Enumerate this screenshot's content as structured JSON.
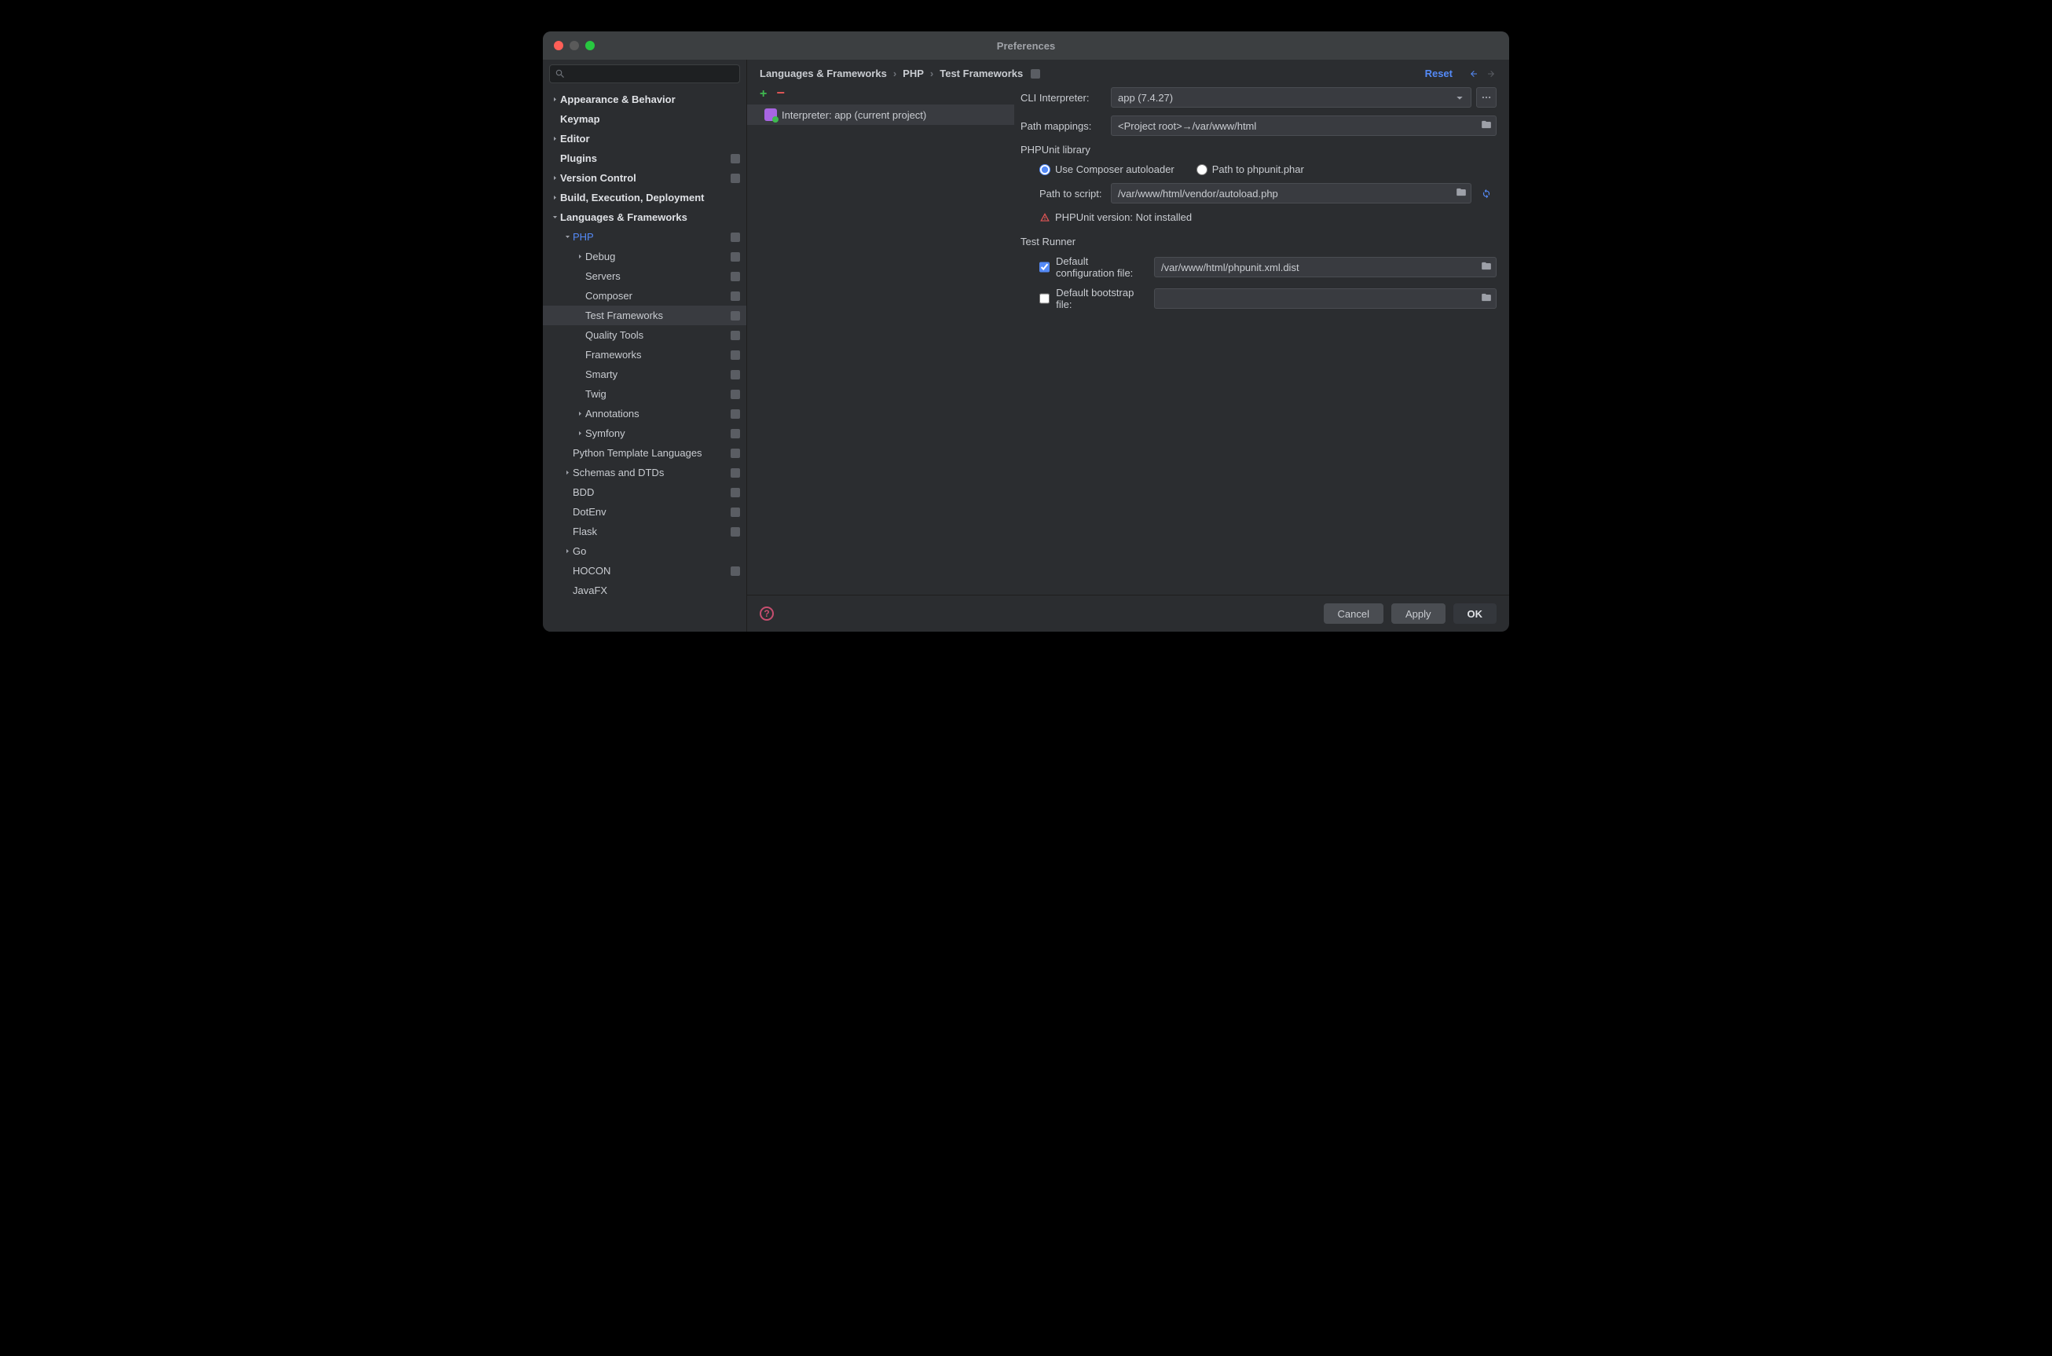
{
  "window": {
    "title": "Preferences"
  },
  "breadcrumb": {
    "a": "Languages & Frameworks",
    "b": "PHP",
    "c": "Test Frameworks"
  },
  "topbar": {
    "reset": "Reset"
  },
  "sidebar": {
    "items": [
      {
        "label": "Appearance & Behavior",
        "indent": 0,
        "chev": "right",
        "bold": true
      },
      {
        "label": "Keymap",
        "indent": 0,
        "bold": true
      },
      {
        "label": "Editor",
        "indent": 0,
        "chev": "right",
        "bold": true
      },
      {
        "label": "Plugins",
        "indent": 0,
        "bold": true,
        "badge": true
      },
      {
        "label": "Version Control",
        "indent": 0,
        "chev": "right",
        "bold": true,
        "badge": true
      },
      {
        "label": "Build, Execution, Deployment",
        "indent": 0,
        "chev": "right",
        "bold": true
      },
      {
        "label": "Languages & Frameworks",
        "indent": 0,
        "chev": "down",
        "bold": true
      },
      {
        "label": "PHP",
        "indent": 1,
        "chev": "down",
        "badge": true,
        "blue": true
      },
      {
        "label": "Debug",
        "indent": 2,
        "chev": "right",
        "badge": true
      },
      {
        "label": "Servers",
        "indent": 2,
        "badge": true
      },
      {
        "label": "Composer",
        "indent": 2,
        "badge": true
      },
      {
        "label": "Test Frameworks",
        "indent": 2,
        "badge": true,
        "selected": true
      },
      {
        "label": "Quality Tools",
        "indent": 2,
        "badge": true
      },
      {
        "label": "Frameworks",
        "indent": 2,
        "badge": true
      },
      {
        "label": "Smarty",
        "indent": 2,
        "badge": true
      },
      {
        "label": "Twig",
        "indent": 2,
        "badge": true
      },
      {
        "label": "Annotations",
        "indent": 2,
        "chev": "right",
        "badge": true
      },
      {
        "label": "Symfony",
        "indent": 2,
        "chev": "right",
        "badge": true
      },
      {
        "label": "Python Template Languages",
        "indent": 1,
        "badge": true
      },
      {
        "label": "Schemas and DTDs",
        "indent": 1,
        "chev": "right",
        "badge": true
      },
      {
        "label": "BDD",
        "indent": 1,
        "badge": true
      },
      {
        "label": "DotEnv",
        "indent": 1,
        "badge": true
      },
      {
        "label": "Flask",
        "indent": 1,
        "badge": true
      },
      {
        "label": "Go",
        "indent": 1,
        "chev": "right"
      },
      {
        "label": "HOCON",
        "indent": 1,
        "badge": true
      },
      {
        "label": "JavaFX",
        "indent": 1
      }
    ]
  },
  "listpanel": {
    "item0": "Interpreter: app (current project)"
  },
  "form": {
    "cli_label": "CLI Interpreter:",
    "cli_value": "app (7.4.27)",
    "path_map_label": "Path mappings:",
    "path_map_value": "<Project root>→/var/www/html",
    "lib_section": "PHPUnit library",
    "radio_composer": "Use Composer autoloader",
    "radio_phar": "Path to phpunit.phar",
    "script_label": "Path to script:",
    "script_value": "/var/www/html/vendor/autoload.php",
    "status": "PHPUnit version: Not installed",
    "runner_section": "Test Runner",
    "def_conf_label": "Default configuration file:",
    "def_conf_value": "/var/www/html/phpunit.xml.dist",
    "def_boot_label": "Default bootstrap file:",
    "def_boot_value": ""
  },
  "footer": {
    "cancel": "Cancel",
    "apply": "Apply",
    "ok": "OK"
  }
}
